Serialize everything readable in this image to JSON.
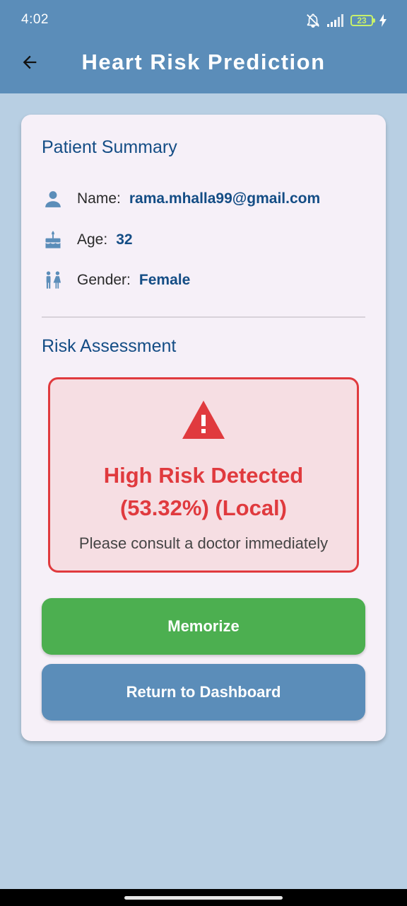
{
  "status_bar": {
    "time": "4:02",
    "battery": "23"
  },
  "app_bar": {
    "title": "Heart Risk Prediction",
    "back_icon": "arrow-back-icon"
  },
  "patient_summary": {
    "title": "Patient Summary",
    "rows": [
      {
        "icon": "person-icon",
        "label": "Name:",
        "value": "rama.mhalla99@gmail.com"
      },
      {
        "icon": "cake-icon",
        "label": "Age:",
        "value": "32"
      },
      {
        "icon": "wc-icon",
        "label": "Gender:",
        "value": "Female"
      }
    ]
  },
  "risk_assessment": {
    "title": "Risk Assessment",
    "icon": "warning-icon",
    "headline_line1": "High Risk Detected",
    "headline_line2": "(53.32%) (Local)",
    "note": "Please consult a doctor immediately"
  },
  "buttons": {
    "memorize": "Memorize",
    "dashboard": "Return to Dashboard"
  },
  "colors": {
    "primary": "#5b8db9",
    "background": "#b8cfe3",
    "card": "#f6f0f8",
    "heading": "#144d85",
    "danger": "#e03a3e",
    "success": "#4caf50"
  }
}
